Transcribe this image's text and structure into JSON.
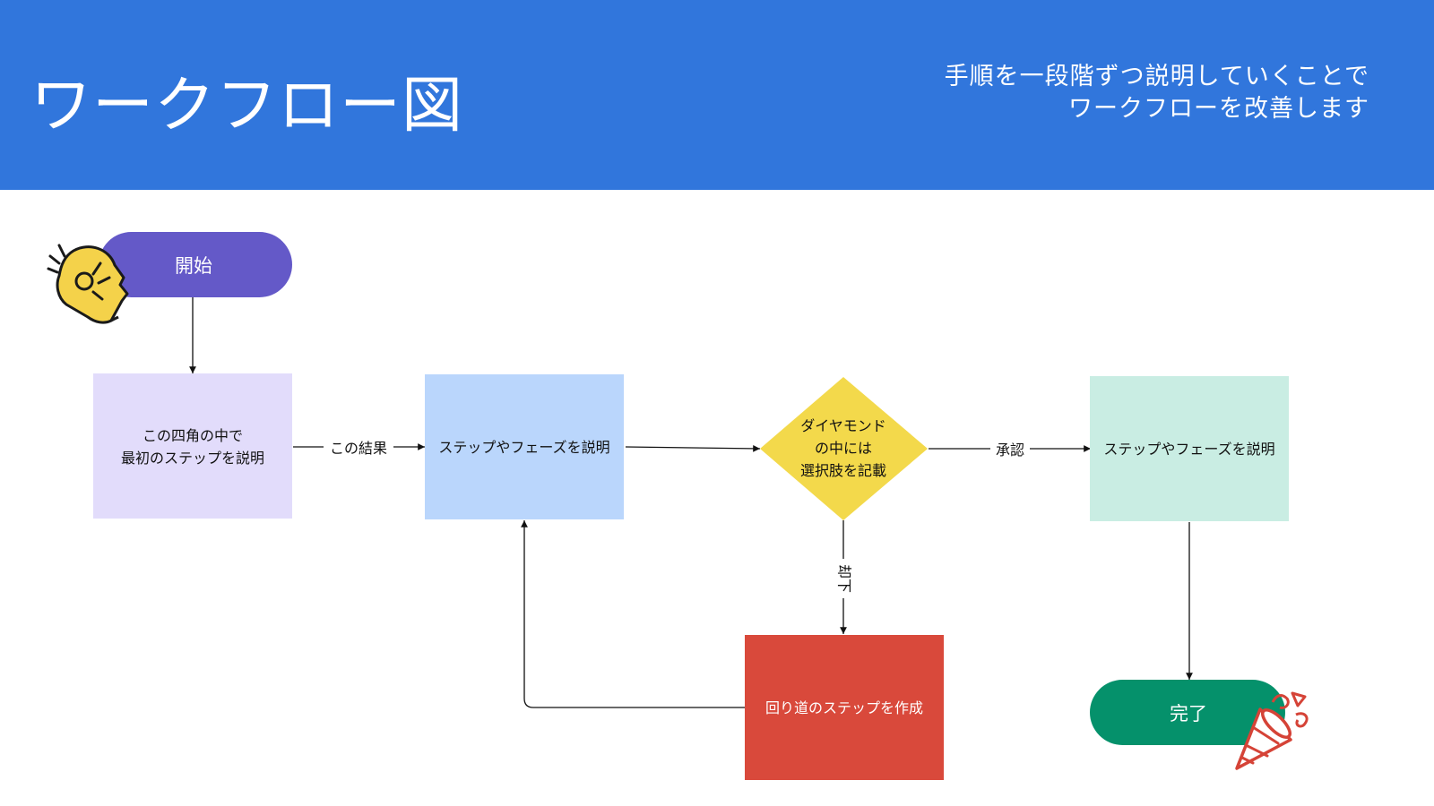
{
  "header": {
    "title": "ワークフロー図",
    "subtitle_line1": "手順を一段階ずつ説明していくことで",
    "subtitle_line2": "ワークフローを改善します"
  },
  "nodes": {
    "start": "開始",
    "step1_line1": "この四角の中で",
    "step1_line2": "最初のステップを説明",
    "step2": "ステップやフェーズを説明",
    "decision_line1": "ダイヤモンド",
    "decision_line2": "の中には",
    "decision_line3": "選択肢を記載",
    "step3": "ステップやフェーズを説明",
    "detour": "回り道のステップを作成",
    "end": "完了"
  },
  "edges": {
    "result": "この結果",
    "approve": "承認",
    "reject": "却下"
  },
  "icons": {
    "start": "ok-hand-icon",
    "end": "party-popper-icon"
  },
  "colors": {
    "header": "#3176dc",
    "start": "#6459c8",
    "step1": "#e2dcfb",
    "step2": "#bad6fc",
    "decision": "#f3d94b",
    "step3": "#c9ede3",
    "detour": "#d9493b",
    "end": "#05916b"
  }
}
